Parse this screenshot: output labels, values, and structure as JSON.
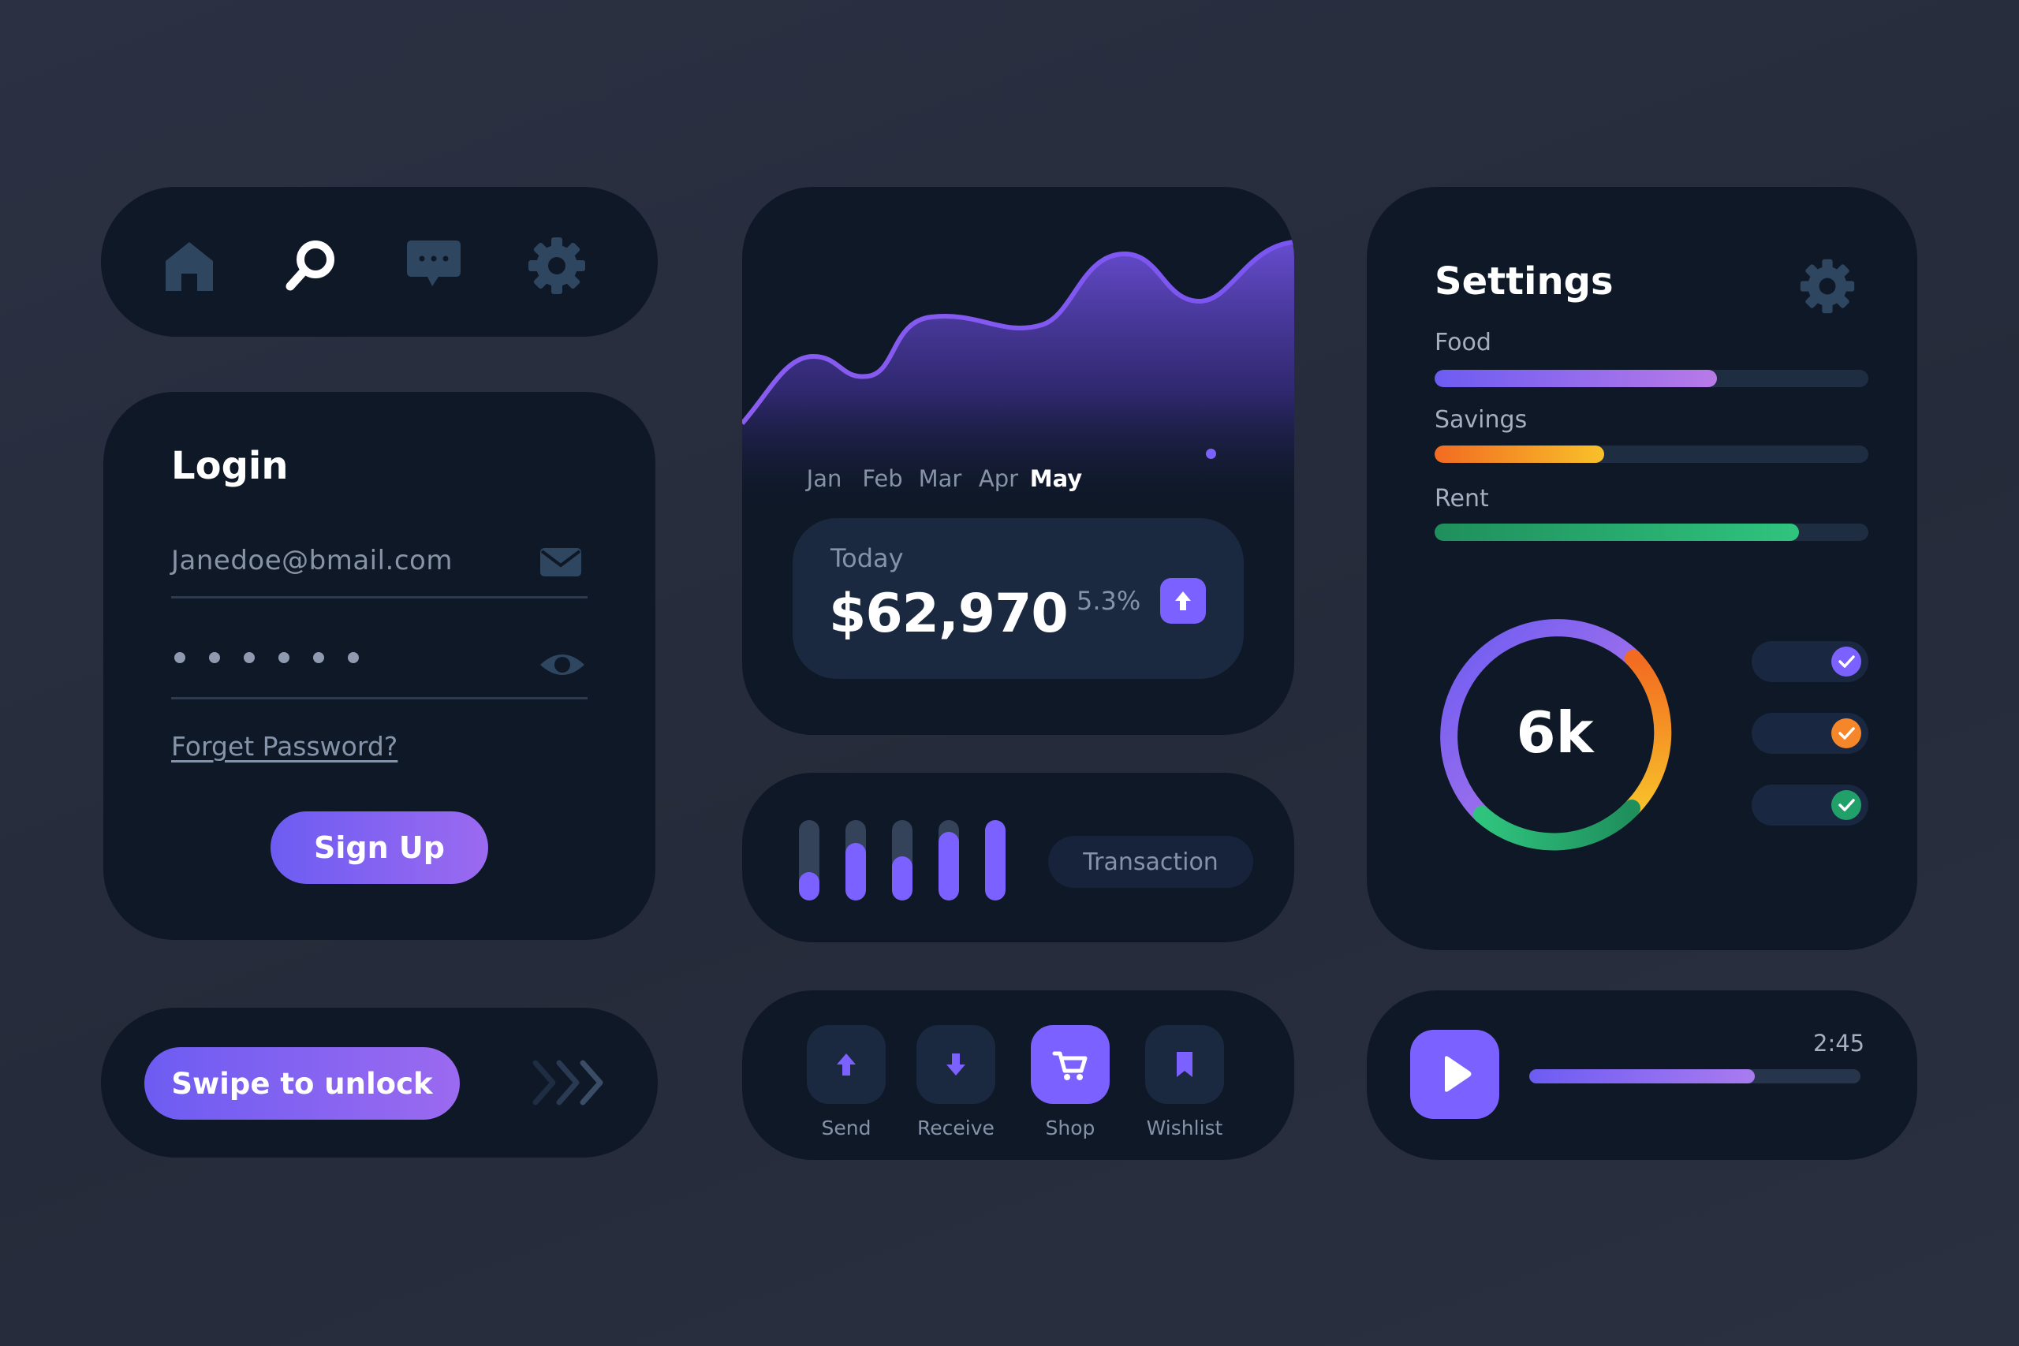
{
  "nav": {
    "items": [
      {
        "name": "home",
        "icon": "home-icon",
        "active": false
      },
      {
        "name": "search",
        "icon": "search-icon",
        "active": true
      },
      {
        "name": "messages",
        "icon": "chat-icon",
        "active": false
      },
      {
        "name": "settings",
        "icon": "gear-icon",
        "active": false
      }
    ]
  },
  "login": {
    "title": "Login",
    "email_value": "Janedoe@bmail.com",
    "email_icon": "envelope-icon",
    "password_dots": 6,
    "password_icon": "eye-icon",
    "forgot_label": "Forget Password?",
    "signup_label": "Sign Up"
  },
  "swipe": {
    "label": "Swipe to unlock",
    "icon": "triple-chevron-right-icon"
  },
  "chart_data": {
    "type": "area",
    "categories": [
      "Jan",
      "Feb",
      "Mar",
      "Apr",
      "May"
    ],
    "highlighted_category": "May",
    "title": "",
    "xlabel": "",
    "ylabel": ""
  },
  "today": {
    "label": "Today",
    "amount": "$62,970",
    "change": "5.3%",
    "change_icon": "arrow-up-icon"
  },
  "transactions": {
    "label": "Transaction",
    "bar_levels": [
      0.35,
      0.72,
      0.55,
      0.85,
      1.0
    ]
  },
  "actions": [
    {
      "label": "Send",
      "icon": "arrow-up-icon",
      "active": false
    },
    {
      "label": "Receive",
      "icon": "arrow-down-icon",
      "active": false
    },
    {
      "label": "Shop",
      "icon": "cart-icon",
      "active": true
    },
    {
      "label": "Wishlist",
      "icon": "bookmark-icon",
      "active": false
    }
  ],
  "settings": {
    "title": "Settings",
    "icon": "gear-icon",
    "categories": [
      {
        "label": "Food",
        "level": 0.65,
        "colors": [
          "#6d5cf2",
          "#b87ae8"
        ]
      },
      {
        "label": "Savings",
        "level": 0.39,
        "colors": [
          "#f26b21",
          "#f8c12a"
        ]
      },
      {
        "label": "Rent",
        "level": 0.84,
        "colors": [
          "#1f8f5c",
          "#2fc47e"
        ]
      }
    ],
    "donut_value": "6k",
    "toggles": [
      {
        "color": "#7b61ff",
        "checked": true
      },
      {
        "color": "#f5862a",
        "checked": true
      },
      {
        "color": "#21a06a",
        "checked": true
      }
    ]
  },
  "player": {
    "time": "2:45",
    "progress": 0.68,
    "play_icon": "play-icon"
  },
  "colors": {
    "accent": "#7b61ff",
    "card": "#0e1826",
    "muted_text": "#8592a7",
    "icon_muted": "#2f4660"
  }
}
